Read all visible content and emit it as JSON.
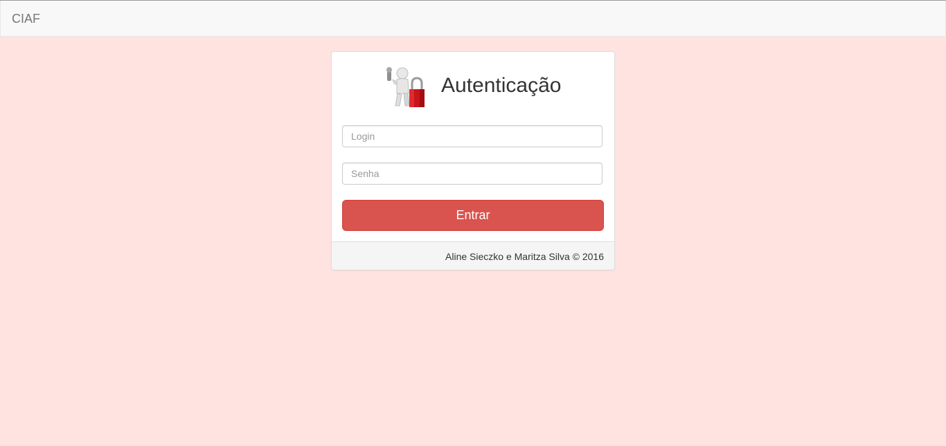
{
  "navbar": {
    "brand": "CIAF"
  },
  "panel": {
    "title": "Autenticação",
    "icon": "person-with-padlock-icon",
    "login_placeholder": "Login",
    "senha_placeholder": "Senha",
    "submit_label": "Entrar",
    "footer_text": "Aline Sieczko e Maritza Silva © 2016"
  },
  "colors": {
    "background": "#fee3e0",
    "button": "#d9534f",
    "navbar": "#f8f8f8"
  }
}
